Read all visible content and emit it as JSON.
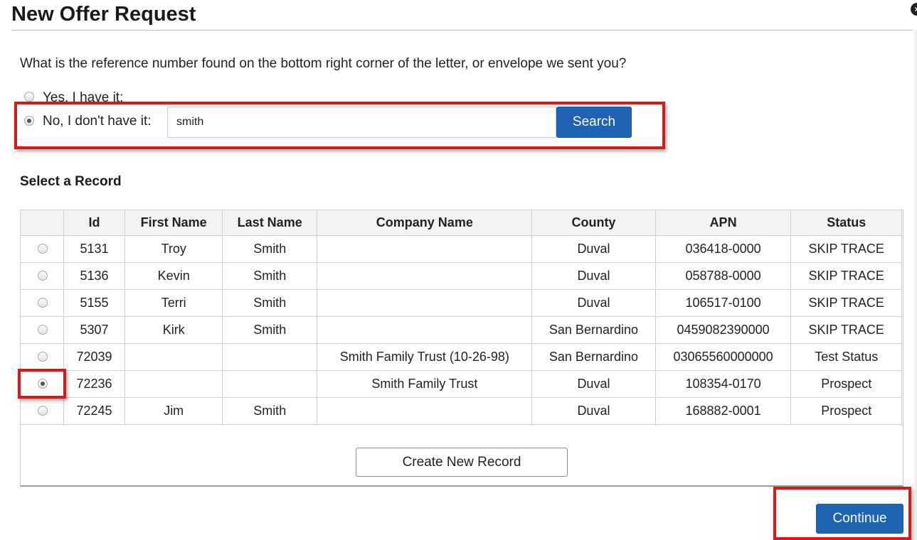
{
  "dialog": {
    "title": "New Offer Request",
    "close_label": "×"
  },
  "reference": {
    "question": "What is the reference number found on the bottom right corner of the letter, or envelope we sent you?",
    "option_yes": "Yes, I have it:",
    "option_no": "No, I don't have it:",
    "selected": "no",
    "search_value": "smith",
    "search_button": "Search"
  },
  "records": {
    "section_title": "Select a Record",
    "columns": [
      "",
      "Id",
      "First Name",
      "Last Name",
      "Company Name",
      "County",
      "APN",
      "Status"
    ],
    "rows": [
      {
        "id": "5131",
        "first": "Troy",
        "last": "Smith",
        "company": "",
        "county": "Duval",
        "apn": "036418-0000",
        "status": "SKIP TRACE",
        "selected": false
      },
      {
        "id": "5136",
        "first": "Kevin",
        "last": "Smith",
        "company": "",
        "county": "Duval",
        "apn": "058788-0000",
        "status": "SKIP TRACE",
        "selected": false
      },
      {
        "id": "5155",
        "first": "Terri",
        "last": "Smith",
        "company": "",
        "county": "Duval",
        "apn": "106517-0100",
        "status": "SKIP TRACE",
        "selected": false
      },
      {
        "id": "5307",
        "first": "Kirk",
        "last": "Smith",
        "company": "",
        "county": "San Bernardino",
        "apn": "0459082390000",
        "status": "SKIP TRACE",
        "selected": false
      },
      {
        "id": "72039",
        "first": "",
        "last": "",
        "company": "Smith Family Trust (10-26-98)",
        "county": "San Bernardino",
        "apn": "03065560000000",
        "status": "Test Status",
        "selected": false
      },
      {
        "id": "72236",
        "first": "",
        "last": "",
        "company": "Smith Family Trust",
        "county": "Duval",
        "apn": "108354-0170",
        "status": "Prospect",
        "selected": true
      },
      {
        "id": "72245",
        "first": "Jim",
        "last": "Smith",
        "company": "",
        "county": "Duval",
        "apn": "168882-0001",
        "status": "Prospect",
        "selected": false
      }
    ],
    "create_button": "Create New Record"
  },
  "footer": {
    "continue_button": "Continue"
  },
  "colors": {
    "primary": "#1e63b4",
    "highlight": "#d61a1a"
  }
}
